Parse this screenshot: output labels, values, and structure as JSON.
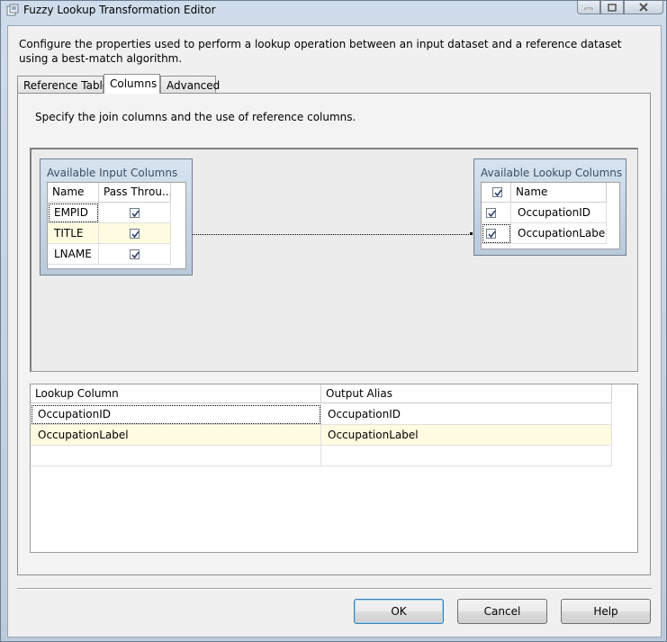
{
  "window": {
    "title": "Fuzzy Lookup Transformation Editor",
    "description": "Configure the properties used to perform a lookup operation between an input dataset and a reference dataset using a best-match algorithm."
  },
  "tabs": [
    {
      "label": "Reference Table",
      "active": false
    },
    {
      "label": "Columns",
      "active": true
    },
    {
      "label": "Advanced",
      "active": false
    }
  ],
  "columns_tab": {
    "description": "Specify the join columns and the use of reference columns.",
    "input_box": {
      "title": "Available Input Columns",
      "headers": [
        "Name",
        "Pass Throu..."
      ],
      "rows": [
        {
          "name": "EMPID",
          "pass_through": true
        },
        {
          "name": "TITLE",
          "pass_through": true
        },
        {
          "name": "LNAME",
          "pass_through": true
        }
      ]
    },
    "lookup_box": {
      "title": "Available Lookup Columns",
      "headers": [
        "",
        "Name"
      ],
      "header_checked": true,
      "rows": [
        {
          "name": "OccupationID",
          "checked": true
        },
        {
          "name": "OccupationLabel",
          "checked": true
        }
      ]
    },
    "mapping_grid": {
      "headers": [
        "Lookup Column",
        "Output Alias"
      ],
      "rows": [
        {
          "lookup_column": "OccupationID",
          "output_alias": "OccupationID"
        },
        {
          "lookup_column": "OccupationLabel",
          "output_alias": "OccupationLabel"
        }
      ]
    }
  },
  "buttons": {
    "ok": "OK",
    "cancel": "Cancel",
    "help": "Help"
  },
  "colors": {
    "selected_row": "#fffbe0",
    "box_header": "#3a4f66"
  }
}
